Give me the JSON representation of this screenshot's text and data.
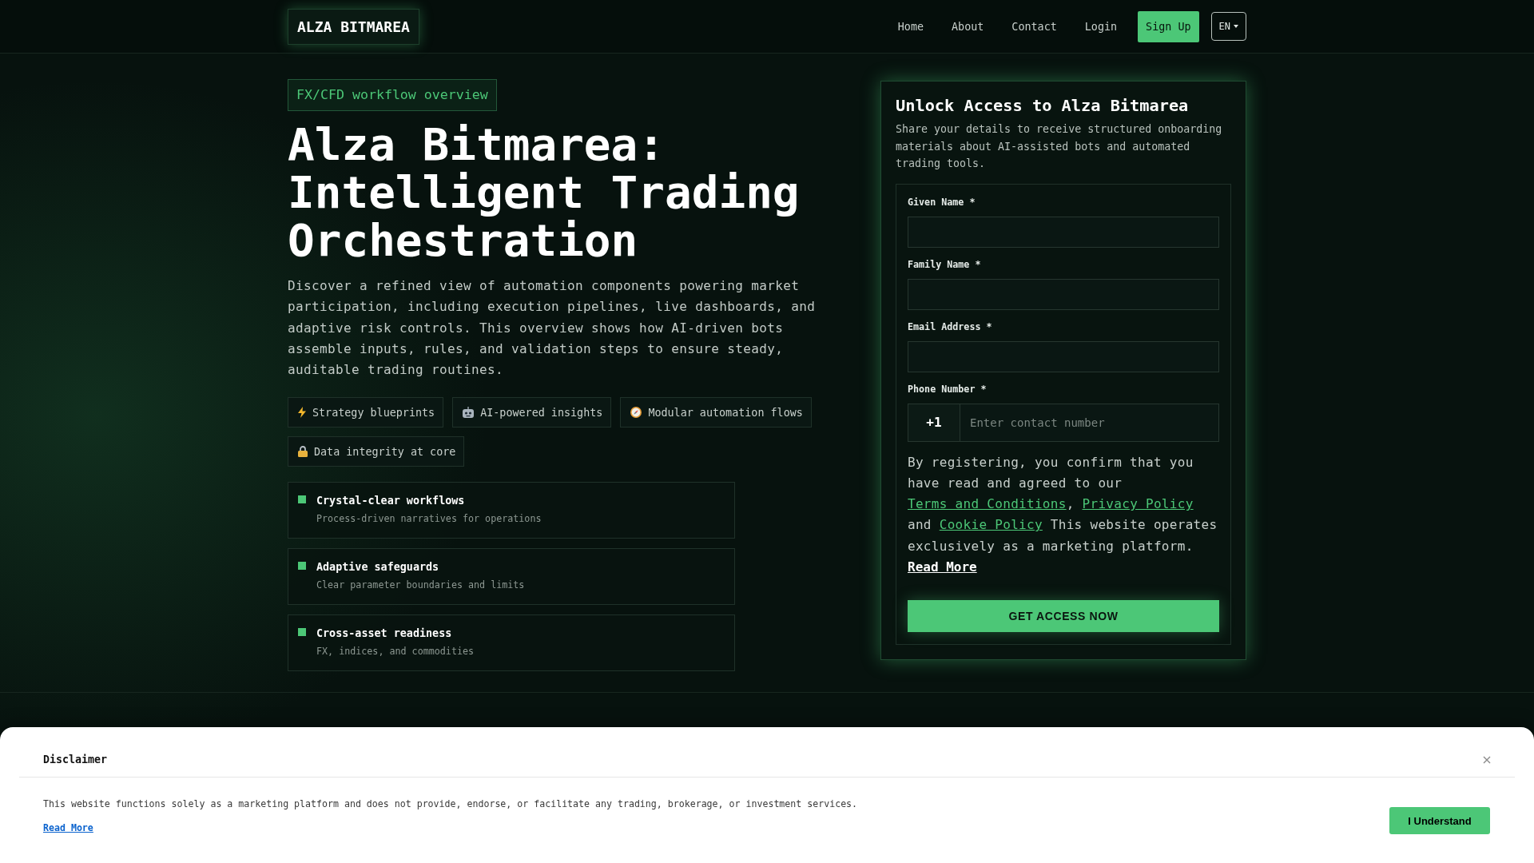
{
  "header": {
    "logo": "ALZA BITMAREA",
    "nav": [
      "Home",
      "About",
      "Contact",
      "Login"
    ],
    "signup_button": "Sign Up",
    "language": "EN"
  },
  "hero": {
    "badge": "FX/CFD workflow overview",
    "title": "Alza Bitmarea: Intelligent Trading Orchestration",
    "description": "Discover a refined view of automation components powering market participation, including execution pipelines, live dashboards, and adaptive risk controls. This overview shows how AI-driven bots assemble inputs, rules, and validation steps to ensure steady, auditable trading routines.",
    "tags": [
      "Strategy blueprints",
      "AI-powered insights",
      "Modular automation flows",
      "Data integrity at core"
    ],
    "features": [
      {
        "title": "Crystal-clear workflows",
        "description": "Process-driven narratives for operations"
      },
      {
        "title": "Adaptive safeguards",
        "description": "Clear parameter boundaries and limits"
      },
      {
        "title": "Cross-asset readiness",
        "description": "FX, indices, and commodities"
      }
    ]
  },
  "signup_form": {
    "title": "Unlock Access to Alza Bitmarea",
    "subtitle": "Share your details to receive structured onboarding materials about AI-assisted bots and automated trading tools.",
    "fields": [
      {
        "kind": "text",
        "label": "Given Name *"
      },
      {
        "kind": "text",
        "label": "Family Name *"
      },
      {
        "kind": "email",
        "label": "Email Address *"
      },
      {
        "kind": "phone",
        "label": "Phone Number *",
        "prefix": "+1",
        "placeholder": "Enter contact number"
      }
    ],
    "consent": [
      {
        "kind": "text",
        "text": "By registering, you confirm that you have read and agreed to our "
      },
      {
        "kind": "link",
        "text": "Terms and Conditions"
      },
      {
        "kind": "text",
        "text": ", "
      },
      {
        "kind": "link",
        "text": "Privacy Policy"
      },
      {
        "kind": "text",
        "text": " and "
      },
      {
        "kind": "link",
        "text": "Cookie Policy"
      },
      {
        "kind": "text",
        "text": " This website operates exclusively as a marketing platform."
      }
    ],
    "read_more": "Read More",
    "submit_button": "GET ACCESS NOW"
  },
  "disclaimer": {
    "title": "Disclaimer",
    "text": "This website functions solely as a marketing platform and does not provide, endorse, or facilitate any trading, brokerage, or investment services.",
    "read_more": "Read More",
    "button": "I Understand"
  }
}
